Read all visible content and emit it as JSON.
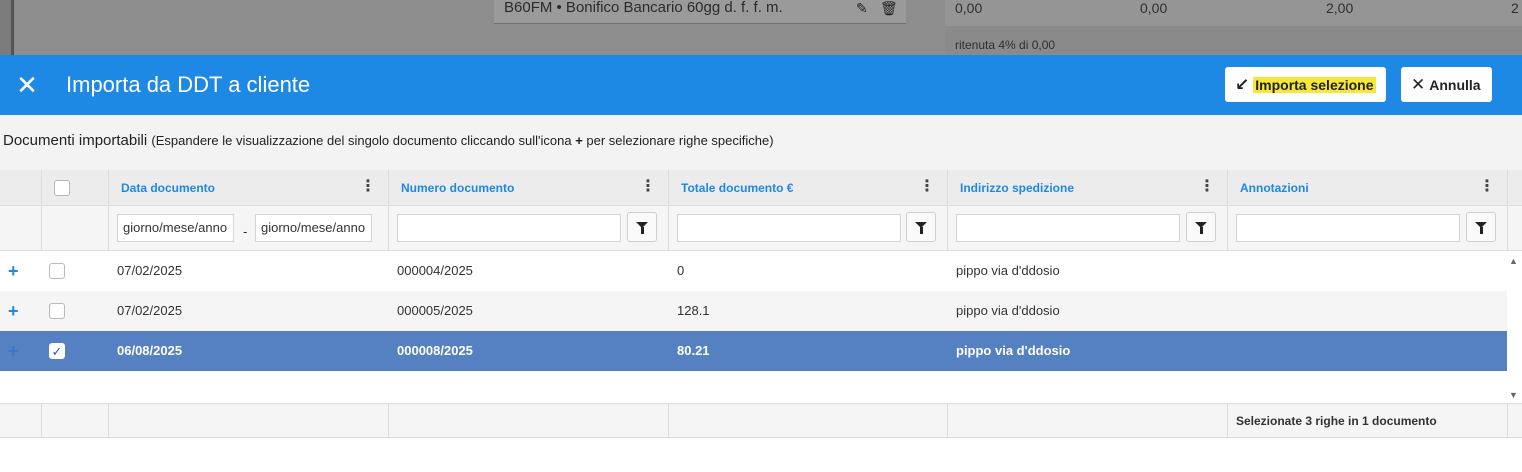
{
  "background": {
    "payment_text": "B60FM • Bonifico Bancario 60gg d. f. f. m.",
    "summary_values": [
      "0,00",
      "0,00",
      "2,00",
      "2"
    ],
    "ritenuta_text": "ritenuta  4% di 0,00"
  },
  "header": {
    "title": "Importa da DDT a cliente",
    "import_label": "Importa selezione",
    "cancel_label": "Annulla"
  },
  "subtitle": {
    "main": "Documenti importabili",
    "note_pre": "(Espandere le visualizzazione del singolo documento cliccando sull'icona ",
    "note_plus": "+",
    "note_post": " per selezionare righe specifiche)"
  },
  "columns": [
    "Data documento",
    "Numero documento",
    "Totale documento €",
    "Indirizzo spedizione",
    "Annotazioni"
  ],
  "filters": {
    "date_from_placeholder": "giorno/mese/anno",
    "date_to_placeholder": "giorno/mese/anno",
    "range_separator": "-"
  },
  "rows": [
    {
      "date": "07/02/2025",
      "number": "000004/2025",
      "total": "0",
      "address": "pippo via d'ddosio",
      "notes": "",
      "checked": false
    },
    {
      "date": "07/02/2025",
      "number": "000005/2025",
      "total": "128.1",
      "address": "pippo via d'ddosio",
      "notes": "",
      "checked": false
    },
    {
      "date": "06/08/2025",
      "number": "000008/2025",
      "total": "80.21",
      "address": "pippo via d'ddosio",
      "notes": "",
      "checked": true
    }
  ],
  "footer": {
    "selection_text": "Selezionate 3 righe in 1 documento"
  },
  "colors": {
    "accent": "#1e88e5",
    "selected_row": "#5580c2",
    "highlight": "#f5e83b"
  }
}
